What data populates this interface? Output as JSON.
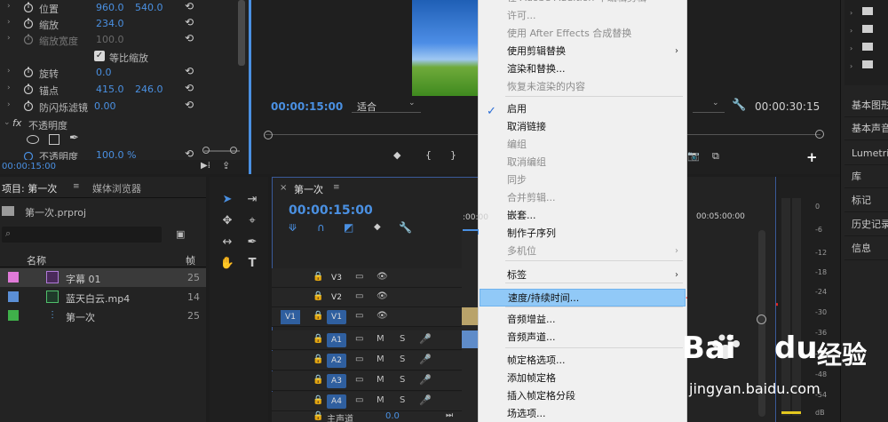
{
  "effect_controls": {
    "rows": [
      {
        "label": "位置",
        "v1": "960.0",
        "v2": "540.0"
      },
      {
        "label": "缩放",
        "v1": "234.0",
        "v2": ""
      },
      {
        "label": "缩放宽度",
        "v1": "100.0",
        "v2": ""
      },
      {
        "label": "等比缩放",
        "v1": "",
        "v2": ""
      },
      {
        "label": "旋转",
        "v1": "0.0",
        "v2": ""
      },
      {
        "label": "锚点",
        "v1": "415.0",
        "v2": "246.0"
      },
      {
        "label": "防闪烁滤镜",
        "v1": "0.00",
        "v2": ""
      },
      {
        "label": "不透明度",
        "v1": "",
        "v2": ""
      },
      {
        "label": "不透明度",
        "v1": "100.0 %",
        "v2": ""
      }
    ],
    "fx_label": "fx",
    "timecode": "00:00:15:00"
  },
  "program_monitor": {
    "timecode_left": "00:00:15:00",
    "fit_label": "适合",
    "timecode_right": "00:00:30:15"
  },
  "project_panel": {
    "tab_project": "项目: 第一次",
    "tab_media": "媒体浏览器",
    "project_file": "第一次.prproj",
    "col_name": "名称",
    "col_extra": "帧",
    "items": [
      {
        "name": "字幕 01",
        "extra": "25",
        "color": "#e07ad8"
      },
      {
        "name": "蓝天白云.mp4",
        "extra": "14",
        "color": "#5b8fd6"
      },
      {
        "name": "第一次",
        "extra": "25",
        "color": "#3fb04a"
      }
    ]
  },
  "timeline": {
    "tab_label": "第一次",
    "timecode": "00:00:15:00",
    "ruler_left": ":00:00",
    "ruler_right": "00:05:00:00",
    "tracks": [
      {
        "tag": "",
        "name": "V3",
        "kind": "video"
      },
      {
        "tag": "",
        "name": "V2",
        "kind": "video"
      },
      {
        "tag": "V1",
        "name": "V1",
        "kind": "video"
      },
      {
        "tag": "",
        "name": "A1",
        "kind": "audio"
      },
      {
        "tag": "",
        "name": "A2",
        "kind": "audio"
      },
      {
        "tag": "",
        "name": "A3",
        "kind": "audio"
      },
      {
        "tag": "",
        "name": "A4",
        "kind": "audio"
      }
    ],
    "master_label": "主声道",
    "master_value": "0.0",
    "m_label": "M",
    "s_label": "S"
  },
  "context_menu": {
    "top_partial": "在 Adobe Audition 中编辑剪辑",
    "items": [
      {
        "label": "许可...",
        "enabled": false,
        "submenu": false
      },
      {
        "label": "使用 After Effects 合成替换",
        "enabled": false,
        "submenu": false
      },
      {
        "label": "使用剪辑替换",
        "enabled": true,
        "submenu": true
      },
      {
        "label": "渲染和替换...",
        "enabled": true,
        "submenu": false
      },
      {
        "label": "恢复未渲染的内容",
        "enabled": false,
        "submenu": false
      },
      {
        "label": "启用",
        "enabled": true,
        "submenu": false,
        "checked": true
      },
      {
        "label": "取消链接",
        "enabled": true,
        "submenu": false
      },
      {
        "label": "编组",
        "enabled": false,
        "submenu": false
      },
      {
        "label": "取消编组",
        "enabled": false,
        "submenu": false
      },
      {
        "label": "同步",
        "enabled": false,
        "submenu": false
      },
      {
        "label": "合并剪辑...",
        "enabled": false,
        "submenu": false
      },
      {
        "label": "嵌套...",
        "enabled": true,
        "submenu": false
      },
      {
        "label": "制作子序列",
        "enabled": true,
        "submenu": false
      },
      {
        "label": "多机位",
        "enabled": false,
        "submenu": true
      },
      {
        "label": "标签",
        "enabled": true,
        "submenu": true
      },
      {
        "label": "速度/持续时间...",
        "enabled": true,
        "submenu": false,
        "highlighted": true
      },
      {
        "label": "音频增益...",
        "enabled": true,
        "submenu": false
      },
      {
        "label": "音频声道...",
        "enabled": true,
        "submenu": false
      },
      {
        "label": "帧定格选项...",
        "enabled": true,
        "submenu": false
      },
      {
        "label": "添加帧定格",
        "enabled": true,
        "submenu": false
      },
      {
        "label": "插入帧定格分段",
        "enabled": true,
        "submenu": false
      },
      {
        "label": "场选项...",
        "enabled": true,
        "submenu": false
      }
    ]
  },
  "right_panel": {
    "items": [
      "基本图形",
      "基本声音",
      "Lumetri 范围",
      "库",
      "标记",
      "历史记录",
      "信息"
    ]
  },
  "audio_meter": {
    "labels": [
      "0",
      "-6",
      "-12",
      "-18",
      "-24",
      "-30",
      "-36",
      "-42",
      "-48",
      "-54"
    ],
    "unit": "dB"
  },
  "watermark": {
    "brand_a": "Bai",
    "brand_b": "du",
    "brand_cn": "经验",
    "url": "jingyan.baidu.com"
  },
  "colors": {
    "accent_blue": "#4a90e2",
    "menu_highlight": "#91c9f7",
    "annotation_arrow": "#e8231e"
  }
}
